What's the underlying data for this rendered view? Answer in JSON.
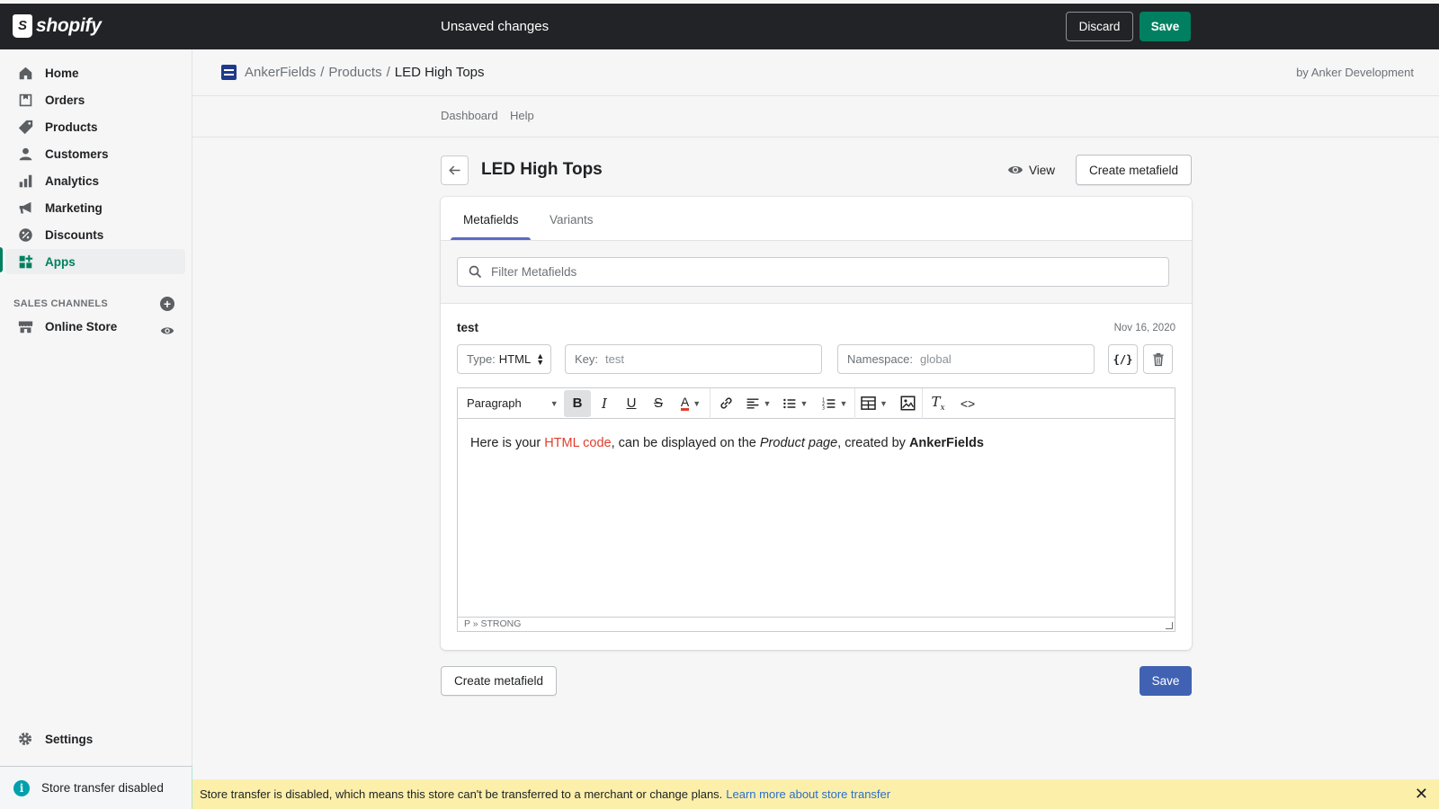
{
  "topbar": {
    "brand": "shopify",
    "status": "Unsaved changes",
    "discard_label": "Discard",
    "save_label": "Save"
  },
  "sidebar": {
    "items": [
      {
        "label": "Home",
        "icon": "home-icon"
      },
      {
        "label": "Orders",
        "icon": "orders-icon"
      },
      {
        "label": "Products",
        "icon": "tag-icon"
      },
      {
        "label": "Customers",
        "icon": "person-icon"
      },
      {
        "label": "Analytics",
        "icon": "bar-chart-icon"
      },
      {
        "label": "Marketing",
        "icon": "megaphone-icon"
      },
      {
        "label": "Discounts",
        "icon": "discount-icon"
      },
      {
        "label": "Apps",
        "icon": "apps-icon"
      }
    ],
    "active_item": "Apps",
    "sales_channels_heading": "SALES CHANNELS",
    "online_store_label": "Online Store",
    "settings_label": "Settings",
    "store_transfer_label": "Store transfer disabled",
    "accent_color": "#008060"
  },
  "appbar": {
    "crumb_app": "AnkerFields",
    "crumb_section": "Products",
    "crumb_current": "LED High Tops",
    "separator": "/",
    "developer": "by Anker Development"
  },
  "subnav": {
    "dashboard": "Dashboard",
    "help": "Help"
  },
  "page": {
    "title": "LED High Tops",
    "view_label": "View",
    "create_metafield_label": "Create metafield"
  },
  "tabs": {
    "metafields": "Metafields",
    "variants": "Variants",
    "active": "Metafields"
  },
  "filter": {
    "placeholder": "Filter Metafields"
  },
  "metafield": {
    "name": "test",
    "date": "Nov 16, 2020",
    "type_prefix": "Type:",
    "type_value": "HTML",
    "key_prefix": "Key:",
    "key_value": "test",
    "namespace_prefix": "Namespace:",
    "namespace_value": "global",
    "code_toggle": "{/}"
  },
  "editor": {
    "block_format": "Paragraph",
    "content": {
      "part1": "Here is your ",
      "link_text": "HTML code",
      "part2": ", can be displayed on the ",
      "italic": "Product page",
      "part3": ", created by ",
      "bold": "AnkerFields"
    },
    "path": "P » STRONG",
    "text_color": "#e03e2d"
  },
  "footer": {
    "create_metafield_label": "Create metafield",
    "save_label": "Save"
  },
  "banner": {
    "message": "Store transfer is disabled, which means this store can't be transferred to a merchant or change plans.",
    "link_text": "Learn more about store transfer"
  }
}
